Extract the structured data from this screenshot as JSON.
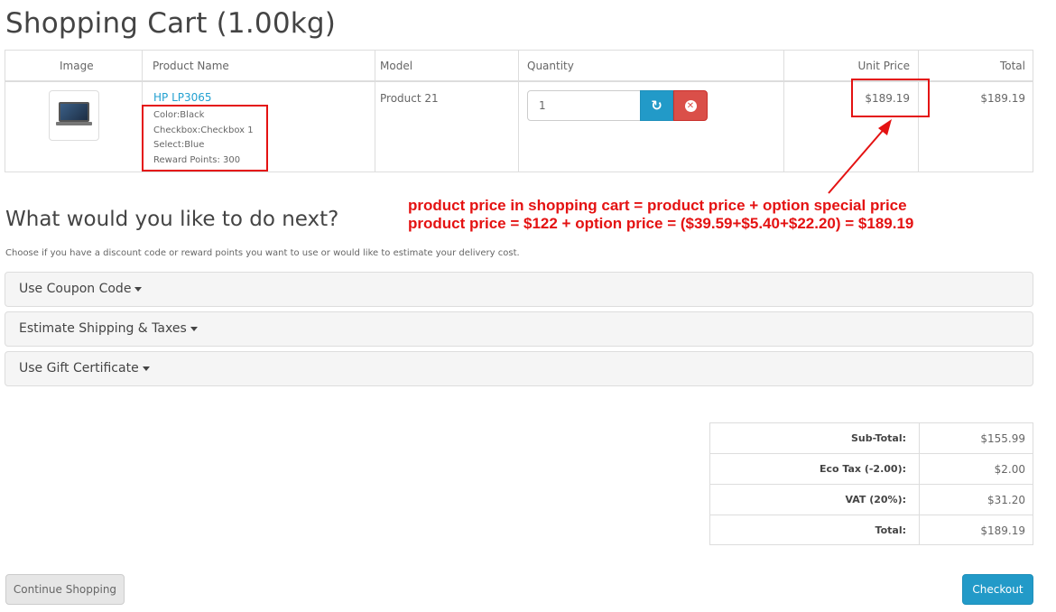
{
  "page": {
    "title": "Shopping Cart  (1.00kg)"
  },
  "cart_table": {
    "headers": {
      "image": "Image",
      "product_name": "Product Name",
      "model": "Model",
      "quantity": "Quantity",
      "unit_price": "Unit Price",
      "total": "Total"
    },
    "row": {
      "product_name": "HP LP3065",
      "options": [
        "Color:Black",
        "Checkbox:Checkbox 1",
        "Select:Blue",
        "Reward Points: 300"
      ],
      "model": "Product 21",
      "quantity": "1",
      "unit_price": "$189.19",
      "total": "$189.19"
    },
    "refresh_icon": "refresh-icon",
    "remove_icon": "times-circle-icon"
  },
  "annotation": {
    "line1": "product price in shopping cart = product price + option special price",
    "line2": "product price = $122 + option price = ($39.59+$5.40+$22.20) = $189.19",
    "color": "#e41212"
  },
  "next": {
    "title": "What would you like to do next?",
    "description": "Choose if you have a discount code or reward points you want to use or would like to estimate your delivery cost.",
    "panels": [
      "Use Coupon Code",
      "Estimate Shipping & Taxes",
      "Use Gift Certificate"
    ]
  },
  "totals": [
    {
      "label": "Sub-Total:",
      "value": "$155.99"
    },
    {
      "label": "Eco Tax (-2.00):",
      "value": "$2.00"
    },
    {
      "label": "VAT (20%):",
      "value": "$31.20"
    },
    {
      "label": "Total:",
      "value": "$189.19"
    }
  ],
  "buttons": {
    "continue": "Continue Shopping",
    "checkout": "Checkout"
  },
  "colors": {
    "accent": "#229ac8",
    "danger": "#da4f49",
    "link": "#23a1d1"
  }
}
